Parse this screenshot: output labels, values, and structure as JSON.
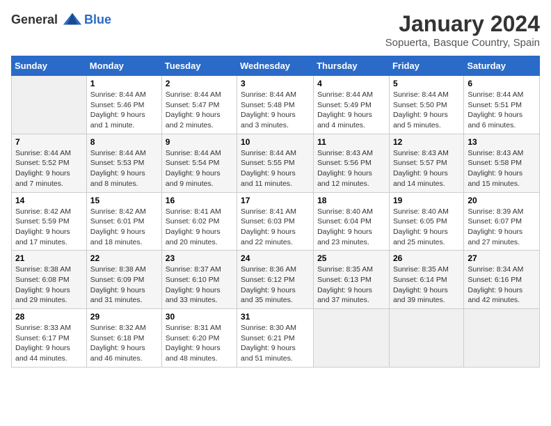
{
  "header": {
    "logo_general": "General",
    "logo_blue": "Blue",
    "title": "January 2024",
    "subtitle": "Sopuerta, Basque Country, Spain"
  },
  "weekdays": [
    "Sunday",
    "Monday",
    "Tuesday",
    "Wednesday",
    "Thursday",
    "Friday",
    "Saturday"
  ],
  "weeks": [
    [
      {
        "day": "",
        "content": ""
      },
      {
        "day": "1",
        "content": "Sunrise: 8:44 AM\nSunset: 5:46 PM\nDaylight: 9 hours\nand 1 minute."
      },
      {
        "day": "2",
        "content": "Sunrise: 8:44 AM\nSunset: 5:47 PM\nDaylight: 9 hours\nand 2 minutes."
      },
      {
        "day": "3",
        "content": "Sunrise: 8:44 AM\nSunset: 5:48 PM\nDaylight: 9 hours\nand 3 minutes."
      },
      {
        "day": "4",
        "content": "Sunrise: 8:44 AM\nSunset: 5:49 PM\nDaylight: 9 hours\nand 4 minutes."
      },
      {
        "day": "5",
        "content": "Sunrise: 8:44 AM\nSunset: 5:50 PM\nDaylight: 9 hours\nand 5 minutes."
      },
      {
        "day": "6",
        "content": "Sunrise: 8:44 AM\nSunset: 5:51 PM\nDaylight: 9 hours\nand 6 minutes."
      }
    ],
    [
      {
        "day": "7",
        "content": "Sunrise: 8:44 AM\nSunset: 5:52 PM\nDaylight: 9 hours\nand 7 minutes."
      },
      {
        "day": "8",
        "content": "Sunrise: 8:44 AM\nSunset: 5:53 PM\nDaylight: 9 hours\nand 8 minutes."
      },
      {
        "day": "9",
        "content": "Sunrise: 8:44 AM\nSunset: 5:54 PM\nDaylight: 9 hours\nand 9 minutes."
      },
      {
        "day": "10",
        "content": "Sunrise: 8:44 AM\nSunset: 5:55 PM\nDaylight: 9 hours\nand 11 minutes."
      },
      {
        "day": "11",
        "content": "Sunrise: 8:43 AM\nSunset: 5:56 PM\nDaylight: 9 hours\nand 12 minutes."
      },
      {
        "day": "12",
        "content": "Sunrise: 8:43 AM\nSunset: 5:57 PM\nDaylight: 9 hours\nand 14 minutes."
      },
      {
        "day": "13",
        "content": "Sunrise: 8:43 AM\nSunset: 5:58 PM\nDaylight: 9 hours\nand 15 minutes."
      }
    ],
    [
      {
        "day": "14",
        "content": "Sunrise: 8:42 AM\nSunset: 5:59 PM\nDaylight: 9 hours\nand 17 minutes."
      },
      {
        "day": "15",
        "content": "Sunrise: 8:42 AM\nSunset: 6:01 PM\nDaylight: 9 hours\nand 18 minutes."
      },
      {
        "day": "16",
        "content": "Sunrise: 8:41 AM\nSunset: 6:02 PM\nDaylight: 9 hours\nand 20 minutes."
      },
      {
        "day": "17",
        "content": "Sunrise: 8:41 AM\nSunset: 6:03 PM\nDaylight: 9 hours\nand 22 minutes."
      },
      {
        "day": "18",
        "content": "Sunrise: 8:40 AM\nSunset: 6:04 PM\nDaylight: 9 hours\nand 23 minutes."
      },
      {
        "day": "19",
        "content": "Sunrise: 8:40 AM\nSunset: 6:05 PM\nDaylight: 9 hours\nand 25 minutes."
      },
      {
        "day": "20",
        "content": "Sunrise: 8:39 AM\nSunset: 6:07 PM\nDaylight: 9 hours\nand 27 minutes."
      }
    ],
    [
      {
        "day": "21",
        "content": "Sunrise: 8:38 AM\nSunset: 6:08 PM\nDaylight: 9 hours\nand 29 minutes."
      },
      {
        "day": "22",
        "content": "Sunrise: 8:38 AM\nSunset: 6:09 PM\nDaylight: 9 hours\nand 31 minutes."
      },
      {
        "day": "23",
        "content": "Sunrise: 8:37 AM\nSunset: 6:10 PM\nDaylight: 9 hours\nand 33 minutes."
      },
      {
        "day": "24",
        "content": "Sunrise: 8:36 AM\nSunset: 6:12 PM\nDaylight: 9 hours\nand 35 minutes."
      },
      {
        "day": "25",
        "content": "Sunrise: 8:35 AM\nSunset: 6:13 PM\nDaylight: 9 hours\nand 37 minutes."
      },
      {
        "day": "26",
        "content": "Sunrise: 8:35 AM\nSunset: 6:14 PM\nDaylight: 9 hours\nand 39 minutes."
      },
      {
        "day": "27",
        "content": "Sunrise: 8:34 AM\nSunset: 6:16 PM\nDaylight: 9 hours\nand 42 minutes."
      }
    ],
    [
      {
        "day": "28",
        "content": "Sunrise: 8:33 AM\nSunset: 6:17 PM\nDaylight: 9 hours\nand 44 minutes."
      },
      {
        "day": "29",
        "content": "Sunrise: 8:32 AM\nSunset: 6:18 PM\nDaylight: 9 hours\nand 46 minutes."
      },
      {
        "day": "30",
        "content": "Sunrise: 8:31 AM\nSunset: 6:20 PM\nDaylight: 9 hours\nand 48 minutes."
      },
      {
        "day": "31",
        "content": "Sunrise: 8:30 AM\nSunset: 6:21 PM\nDaylight: 9 hours\nand 51 minutes."
      },
      {
        "day": "",
        "content": ""
      },
      {
        "day": "",
        "content": ""
      },
      {
        "day": "",
        "content": ""
      }
    ]
  ]
}
